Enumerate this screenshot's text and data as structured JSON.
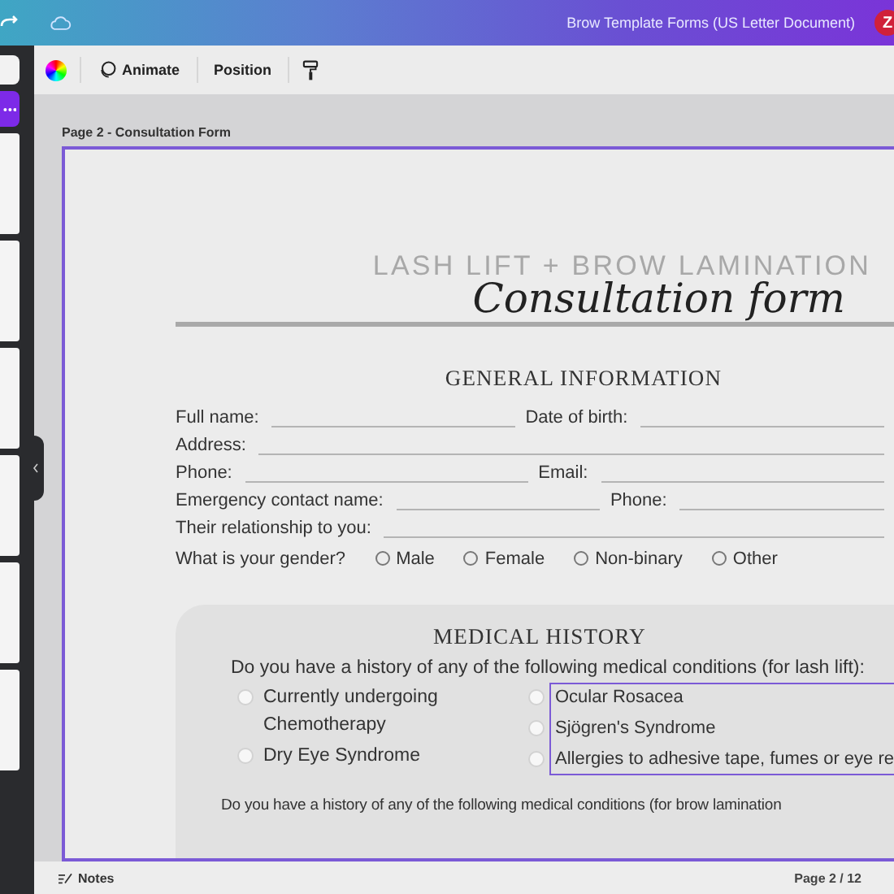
{
  "top_bar": {
    "document_title": "Brow Template Forms (US Letter Document)",
    "avatar_initial": "Z"
  },
  "toolbar": {
    "buttons": [
      "Animate",
      "Position"
    ]
  },
  "page_label": "Page 2 - Consultation Form",
  "form": {
    "subtitle": "LASH LIFT + BROW LAMINATION",
    "title": "Consultation form",
    "general": {
      "heading": "GENERAL INFORMATION",
      "rows": [
        {
          "labels": [
            "Full name:",
            "Date of birth:"
          ]
        },
        {
          "labels": [
            "Address:"
          ]
        },
        {
          "labels": [
            "Phone:",
            "Email:"
          ]
        },
        {
          "labels": [
            "Emergency contact name:",
            "Phone:"
          ]
        },
        {
          "labels": [
            "Their relationship to you:"
          ]
        }
      ],
      "gender_question": "What is your gender?",
      "gender_options": [
        {
          "label": "Male",
          "selected": false
        },
        {
          "label": "Female",
          "selected": false
        },
        {
          "label": "Non-binary",
          "selected": false
        },
        {
          "label": "Other",
          "selected": false
        }
      ]
    },
    "medical": {
      "heading": "MEDICAL HISTORY",
      "question_lash": "Do you have a history of any of the following medical conditions (for lash lift):",
      "conditions_left": [
        {
          "label": "Currently undergoing Chemotherapy",
          "checked": false
        },
        {
          "label": "Dry Eye Syndrome",
          "checked": false
        }
      ],
      "conditions_right": [
        {
          "label": "Ocular Rosacea",
          "checked": false
        },
        {
          "label": "Sjögren's Syndrome",
          "checked": false
        },
        {
          "label": "Allergies to adhesive tape, fumes or eye re",
          "checked": false
        }
      ],
      "question_brow": "Do you have a history of any of the following medical conditions (for brow lamination"
    }
  },
  "bottom_bar": {
    "notes": "Notes",
    "page_indicator": "Page 2 / 12"
  }
}
